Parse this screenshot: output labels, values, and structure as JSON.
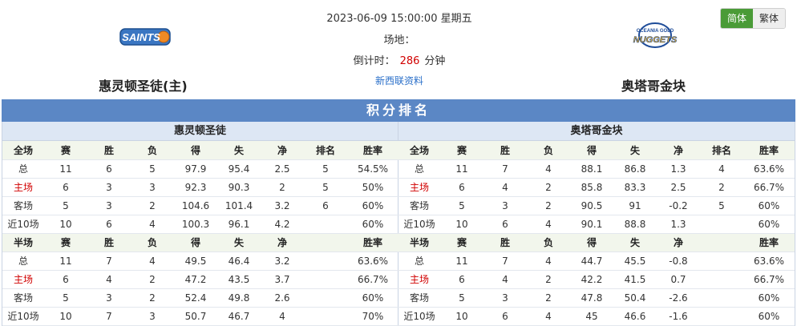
{
  "match": {
    "datetime": "2023-06-09 15:00:00 星期五",
    "venue_label": "场地：",
    "countdown_label": "倒计时：",
    "countdown_value": "286",
    "countdown_unit": "分钟",
    "league_link": "新西联资料"
  },
  "home_team": {
    "name": "惠灵顿圣徒(主)",
    "logo_text": "SAINTS"
  },
  "away_team": {
    "name": "奥塔哥金块",
    "logo_top_text": "OCEANIA GOLD",
    "logo_text": "NUGGETS"
  },
  "lang": {
    "simplified": "简体",
    "traditional": "繁体"
  },
  "standings": {
    "title": "积分排名",
    "home": {
      "team": "惠灵顿圣徒",
      "full_header": [
        "全场",
        "赛",
        "胜",
        "负",
        "得",
        "失",
        "净",
        "排名",
        "胜率"
      ],
      "full_rows": [
        [
          "总",
          "11",
          "6",
          "5",
          "97.9",
          "95.4",
          "2.5",
          "5",
          "54.5%"
        ],
        [
          "主场",
          "6",
          "3",
          "3",
          "92.3",
          "90.3",
          "2",
          "5",
          "50%"
        ],
        [
          "客场",
          "5",
          "3",
          "2",
          "104.6",
          "101.4",
          "3.2",
          "6",
          "60%"
        ],
        [
          "近10场",
          "10",
          "6",
          "4",
          "100.3",
          "96.1",
          "4.2",
          "",
          "60%"
        ]
      ],
      "half_header": [
        "半场",
        "赛",
        "胜",
        "负",
        "得",
        "失",
        "净",
        "",
        "胜率"
      ],
      "half_rows": [
        [
          "总",
          "11",
          "7",
          "4",
          "49.5",
          "46.4",
          "3.2",
          "",
          "63.6%"
        ],
        [
          "主场",
          "6",
          "4",
          "2",
          "47.2",
          "43.5",
          "3.7",
          "",
          "66.7%"
        ],
        [
          "客场",
          "5",
          "3",
          "2",
          "52.4",
          "49.8",
          "2.6",
          "",
          "60%"
        ],
        [
          "近10场",
          "10",
          "7",
          "3",
          "50.7",
          "46.7",
          "4",
          "",
          "70%"
        ]
      ]
    },
    "away": {
      "team": "奥塔哥金块",
      "full_header": [
        "全场",
        "赛",
        "胜",
        "负",
        "得",
        "失",
        "净",
        "排名",
        "胜率"
      ],
      "full_rows": [
        [
          "总",
          "11",
          "7",
          "4",
          "88.1",
          "86.8",
          "1.3",
          "4",
          "63.6%"
        ],
        [
          "主场",
          "6",
          "4",
          "2",
          "85.8",
          "83.3",
          "2.5",
          "2",
          "66.7%"
        ],
        [
          "客场",
          "5",
          "3",
          "2",
          "90.5",
          "91",
          "-0.2",
          "5",
          "60%"
        ],
        [
          "近10场",
          "10",
          "6",
          "4",
          "90.1",
          "88.8",
          "1.3",
          "",
          "60%"
        ]
      ],
      "half_header": [
        "半场",
        "赛",
        "胜",
        "负",
        "得",
        "失",
        "净",
        "",
        "胜率"
      ],
      "half_rows": [
        [
          "总",
          "11",
          "7",
          "4",
          "44.7",
          "45.5",
          "-0.8",
          "",
          "63.6%"
        ],
        [
          "主场",
          "6",
          "4",
          "2",
          "42.2",
          "41.5",
          "0.7",
          "",
          "66.7%"
        ],
        [
          "客场",
          "5",
          "3",
          "2",
          "47.8",
          "50.4",
          "-2.6",
          "",
          "60%"
        ],
        [
          "近10场",
          "10",
          "6",
          "4",
          "45",
          "46.6",
          "-1.6",
          "",
          "60%"
        ]
      ]
    }
  },
  "colors": {
    "accent_green": "#4a9b37",
    "title_bar": "#5b87c5",
    "home_label_red": "#d10000",
    "link_blue": "#2a6fc9"
  }
}
